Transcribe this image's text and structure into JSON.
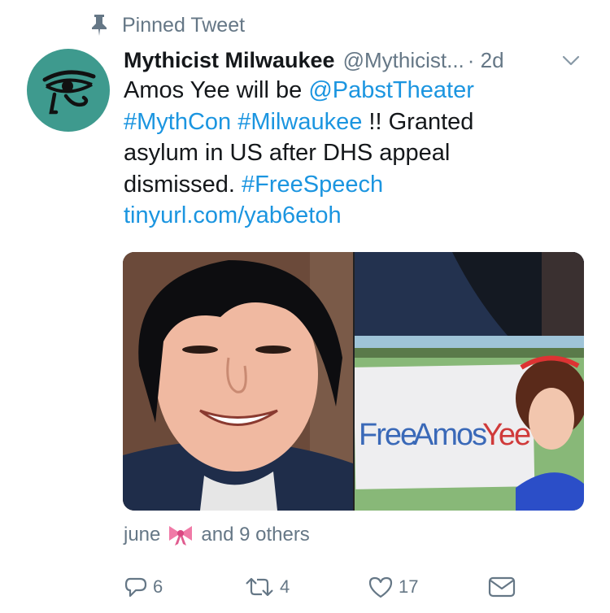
{
  "pinned": {
    "label": "Pinned Tweet",
    "icon": "pin-icon"
  },
  "tweet": {
    "avatar_icon": "eye-of-horus-icon",
    "avatar_color": "#3e9a8e",
    "display_name": "Mythicist Milwaukee",
    "handle": "@Mythicist...",
    "time": "· 2d",
    "text": {
      "l1_plain": "Amos Yee will be ",
      "l1_mention": "@PabstTheater",
      "l2_tag1": "#MythCon",
      "l2_space": " ",
      "l2_tag2": "#Milwaukee",
      "l2_plain": " !! Granted",
      "l3": "asylum in US after DHS appeal",
      "l4_plain": "dismissed. ",
      "l4_tag": "#FreeSpeech",
      "l5_link": "tinyurl.com/yab6etoh"
    },
    "media": {
      "left_alt": "Photo of a smiling young man with dark hair",
      "right_sign_free": "Free",
      "right_sign_amos": "Amos",
      "right_sign_yee": "Yee"
    },
    "likes": {
      "user": "june",
      "emoji_icon": "pink-bow-icon",
      "rest": "and 9 others"
    },
    "actions": {
      "reply_count": "6",
      "retweet_count": "4",
      "like_count": "17"
    },
    "colors": {
      "link": "#1b95e0",
      "secondary": "#657786",
      "text": "#14171a"
    }
  }
}
